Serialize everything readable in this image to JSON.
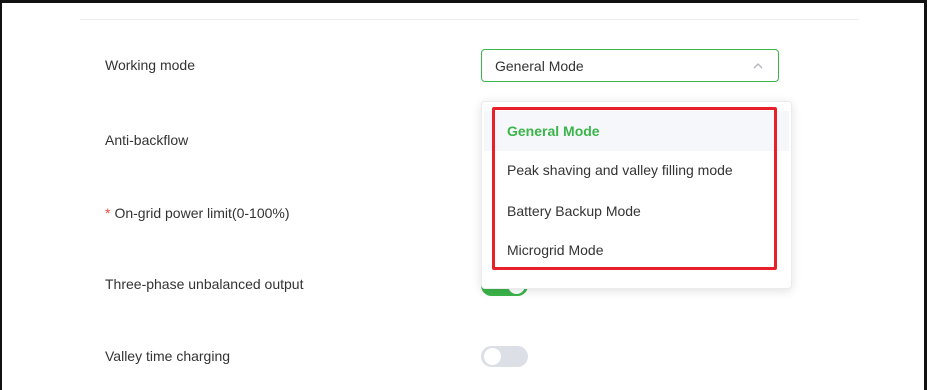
{
  "form": {
    "working_mode_label": "Working mode",
    "anti_backflow_label": "Anti-backflow",
    "ongrid_required_mark": "*",
    "ongrid_label": "On-grid power limit(0-100%)",
    "three_phase_label": "Three-phase unbalanced output",
    "valley_label": "Valley time charging"
  },
  "working_mode": {
    "selected": "General Mode",
    "icon": "chevron-up-icon",
    "options": [
      {
        "label": "General Mode",
        "selected": true
      },
      {
        "label": "Peak shaving and valley filling mode",
        "selected": false
      },
      {
        "label": "Battery Backup Mode",
        "selected": false
      },
      {
        "label": "Microgrid Mode",
        "selected": false
      }
    ]
  },
  "toggles": {
    "three_phase_unbalanced_output": true,
    "valley_time_charging": false
  },
  "colors": {
    "accent": "#3bb54a",
    "highlight_box": "#e8202a",
    "required": "#f5483d",
    "toggle_off": "#dcdfe6"
  }
}
